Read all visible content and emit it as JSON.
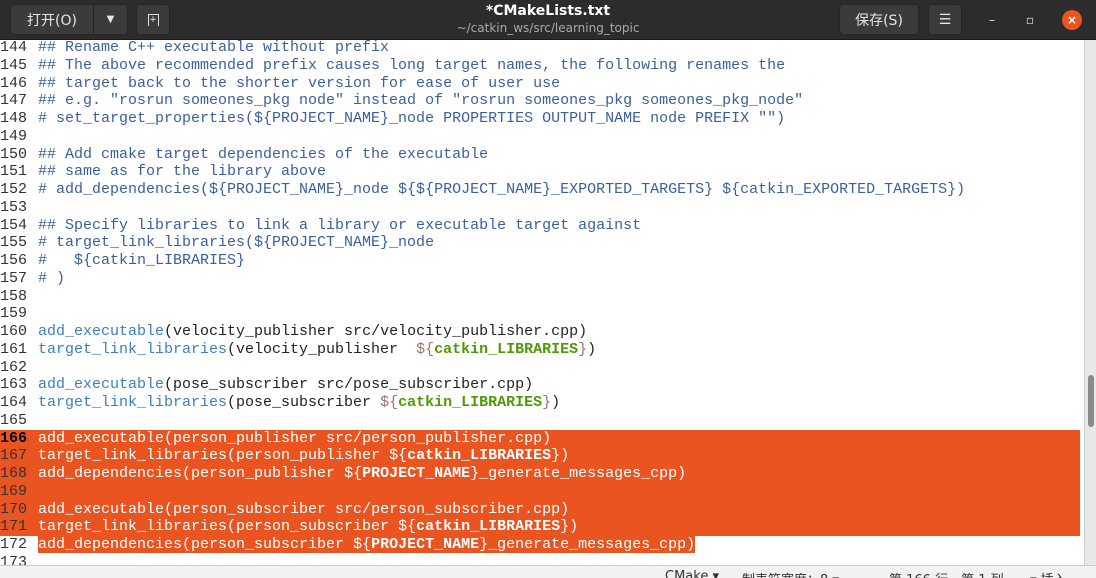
{
  "header": {
    "open_label": "打开(O)",
    "dropdown_icon": "triangle-down",
    "new_tab_icon": "new-document",
    "title": "*CMakeLists.txt",
    "subtitle": "~/catkin_ws/src/learning_topic",
    "save_label": "保存(S)",
    "menu_icon": "hamburger",
    "minimize_icon": "minimize",
    "maximize_icon": "maximize",
    "close_icon": "x"
  },
  "colors": {
    "selection": "#e95420",
    "comment": "#3a5fa0",
    "function": "#3b7fc4",
    "variable": "#4e9a06"
  },
  "editor": {
    "current_line": 166,
    "lines": [
      {
        "n": "144",
        "segs": [
          [
            "c",
            "## Rename C++ executable without prefix"
          ]
        ]
      },
      {
        "n": "145",
        "segs": [
          [
            "c",
            "## The above recommended prefix causes long target names, the following renames the"
          ]
        ]
      },
      {
        "n": "146",
        "segs": [
          [
            "c",
            "## target back to the shorter version for ease of user use"
          ]
        ]
      },
      {
        "n": "147",
        "segs": [
          [
            "c",
            "## e.g. \"rosrun someones_pkg node\" instead of \"rosrun someones_pkg someones_pkg_node\""
          ]
        ]
      },
      {
        "n": "148",
        "segs": [
          [
            "c",
            "# set_target_properties(${PROJECT_NAME}_node PROPERTIES OUTPUT_NAME node PREFIX \"\")"
          ]
        ]
      },
      {
        "n": "149",
        "segs": []
      },
      {
        "n": "150",
        "segs": [
          [
            "c",
            "## Add cmake target dependencies of the executable"
          ]
        ]
      },
      {
        "n": "151",
        "segs": [
          [
            "c",
            "## same as for the library above"
          ]
        ]
      },
      {
        "n": "152",
        "segs": [
          [
            "c",
            "# add_dependencies(${PROJECT_NAME}_node ${${PROJECT_NAME}_EXPORTED_TARGETS} ${catkin_EXPORTED_TARGETS})"
          ]
        ]
      },
      {
        "n": "153",
        "segs": []
      },
      {
        "n": "154",
        "segs": [
          [
            "c",
            "## Specify libraries to link a library or executable target against"
          ]
        ]
      },
      {
        "n": "155",
        "segs": [
          [
            "c",
            "# target_link_libraries(${PROJECT_NAME}_node"
          ]
        ]
      },
      {
        "n": "156",
        "segs": [
          [
            "c",
            "#   ${catkin_LIBRARIES}"
          ]
        ]
      },
      {
        "n": "157",
        "segs": [
          [
            "c",
            "# )"
          ]
        ]
      },
      {
        "n": "158",
        "segs": []
      },
      {
        "n": "159",
        "segs": []
      },
      {
        "n": "160",
        "segs": [
          [
            "f",
            "add_executable"
          ],
          [
            "t",
            "(velocity_publisher src/velocity_publisher.cpp)"
          ]
        ]
      },
      {
        "n": "161",
        "segs": [
          [
            "f",
            "target_link_libraries"
          ],
          [
            "t",
            "(velocity_publisher  "
          ],
          [
            "d",
            "${"
          ],
          [
            "v",
            "catkin_LIBRARIES"
          ],
          [
            "d",
            "}"
          ],
          [
            "t",
            ")"
          ]
        ]
      },
      {
        "n": "162",
        "segs": []
      },
      {
        "n": "163",
        "segs": [
          [
            "f",
            "add_executable"
          ],
          [
            "t",
            "(pose_subscriber src/pose_subscriber.cpp)"
          ]
        ]
      },
      {
        "n": "164",
        "segs": [
          [
            "f",
            "target_link_libraries"
          ],
          [
            "t",
            "(pose_subscriber "
          ],
          [
            "d",
            "${"
          ],
          [
            "v",
            "catkin_LIBRARIES"
          ],
          [
            "d",
            "}"
          ],
          [
            "t",
            ")"
          ]
        ]
      },
      {
        "n": "165",
        "segs": []
      },
      {
        "n": "166",
        "sel": "full",
        "segs": [
          [
            "f",
            "add_executable"
          ],
          [
            "t",
            "(person_publisher src/person_publisher.cpp)"
          ]
        ]
      },
      {
        "n": "167",
        "sel": "full",
        "segs": [
          [
            "f",
            "target_link_libraries"
          ],
          [
            "t",
            "(person_publisher "
          ],
          [
            "d",
            "${"
          ],
          [
            "v",
            "catkin_LIBRARIES"
          ],
          [
            "d",
            "}"
          ],
          [
            "t",
            ")"
          ]
        ]
      },
      {
        "n": "168",
        "sel": "full",
        "segs": [
          [
            "f",
            "add_dependencies"
          ],
          [
            "t",
            "(person_publisher "
          ],
          [
            "d",
            "${"
          ],
          [
            "v",
            "PROJECT_NAME"
          ],
          [
            "d",
            "}"
          ],
          [
            "t",
            "_generate_messages_cpp)"
          ]
        ]
      },
      {
        "n": "169",
        "sel": "full",
        "segs": []
      },
      {
        "n": "170",
        "sel": "full",
        "segs": [
          [
            "f",
            "add_executable"
          ],
          [
            "t",
            "(person_subscriber src/person_subscriber.cpp)"
          ]
        ]
      },
      {
        "n": "171",
        "sel": "full",
        "segs": [
          [
            "f",
            "target_link_libraries"
          ],
          [
            "t",
            "(person_subscriber "
          ],
          [
            "d",
            "${"
          ],
          [
            "v",
            "catkin_LIBRARIES"
          ],
          [
            "d",
            "}"
          ],
          [
            "t",
            ")"
          ]
        ]
      },
      {
        "n": "172",
        "sel": "part",
        "segs": [
          [
            "f",
            "add_dependencies"
          ],
          [
            "t",
            "(person_subscriber "
          ],
          [
            "d",
            "${"
          ],
          [
            "v",
            "PROJECT_NAME"
          ],
          [
            "d",
            "}"
          ],
          [
            "t",
            "_generate_messages_cpp)"
          ]
        ]
      },
      {
        "n": "173",
        "segs": []
      }
    ]
  },
  "status": {
    "language": "CMake ▾",
    "tab_width": "制表符宽度：8 ▾",
    "position": "第 166 行，第 1 列",
    "mode": "▾    插入"
  }
}
